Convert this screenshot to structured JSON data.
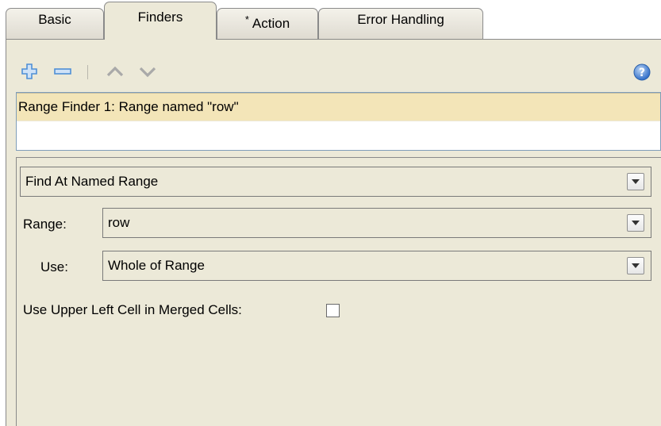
{
  "tabs": [
    {
      "label": "Basic"
    },
    {
      "label": "Finders"
    },
    {
      "label": "Action",
      "marker": "*"
    },
    {
      "label": "Error Handling"
    }
  ],
  "active_tab": "Finders",
  "toolbar": {
    "icons": [
      "plus-icon",
      "minus-icon",
      "up-chevron-icon",
      "down-chevron-icon",
      "help-icon"
    ]
  },
  "finders_list": {
    "items": [
      "Range Finder 1: Range named \"row\""
    ]
  },
  "detail": {
    "finder_type": "Find At Named Range",
    "range_label": "Range:",
    "range_value": "row",
    "use_label": "Use:",
    "use_value": "Whole of Range",
    "merged_label": "Use Upper Left Cell in Merged Cells:",
    "merged_checked": false
  },
  "colors": {
    "panel_bg": "#ece9d8",
    "selected_row": "#f3e5b8",
    "plus_blue": "#4f8fd6",
    "help_blue": "#3b7bd4"
  }
}
